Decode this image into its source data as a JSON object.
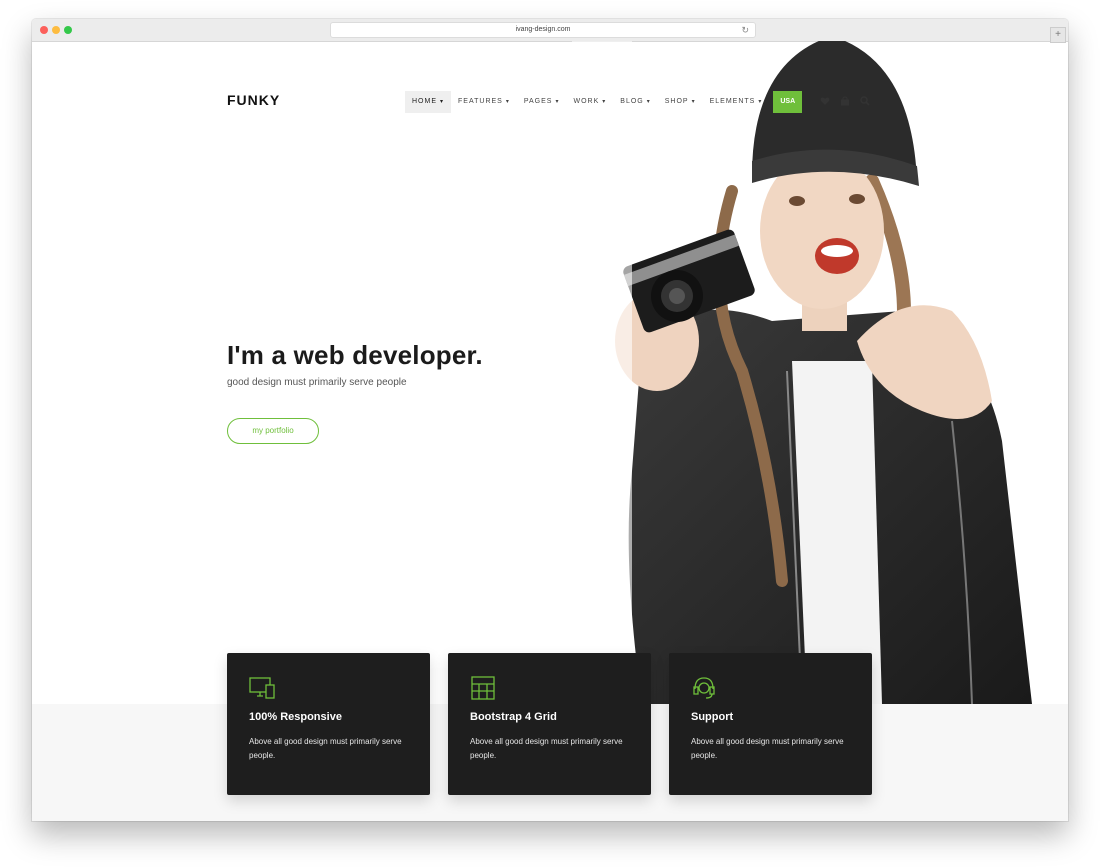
{
  "browser": {
    "url": "ivang-design.com",
    "new_tab": "+"
  },
  "header": {
    "logo": "FUNKY",
    "nav": [
      {
        "label": "HOME",
        "caret": "▾"
      },
      {
        "label": "FEATURES",
        "caret": "▾"
      },
      {
        "label": "PAGES",
        "caret": "▾"
      },
      {
        "label": "WORK",
        "caret": "▾"
      },
      {
        "label": "BLOG",
        "caret": "▾"
      },
      {
        "label": "SHOP",
        "caret": "▾"
      },
      {
        "label": "ELEMENTS",
        "caret": "▾"
      }
    ],
    "badge": "USA",
    "icons": [
      "heart-icon",
      "bag-icon",
      "search-icon"
    ]
  },
  "hero": {
    "headline": "I'm a web developer.",
    "subline": "good design must primarily serve people",
    "button": "my portfolio"
  },
  "features": [
    {
      "icon": "monitor-icon",
      "title": "100% Responsive",
      "text": "Above all good design must primarily serve people."
    },
    {
      "icon": "grid-icon",
      "title": "Bootstrap 4 Grid",
      "text": "Above all good design must primarily serve people."
    },
    {
      "icon": "headset-icon",
      "title": "Support",
      "text": "Above all good design must primarily serve people."
    }
  ],
  "colors": {
    "accent": "#6fbf3b",
    "card": "#1e1e1e"
  }
}
